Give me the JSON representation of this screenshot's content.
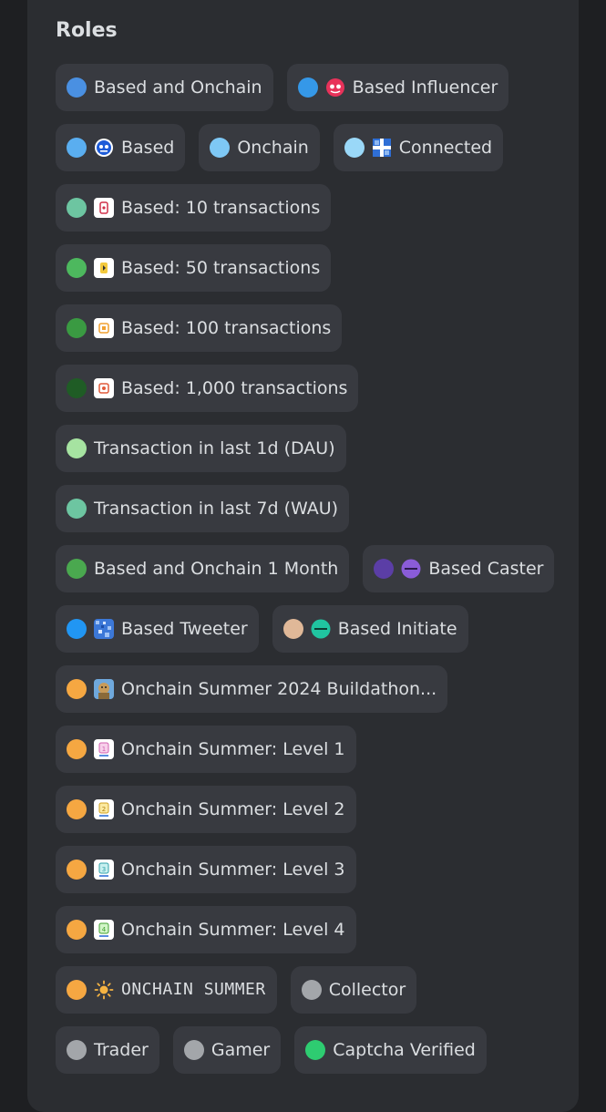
{
  "panel": {
    "title": "Roles"
  },
  "rows": [
    [
      {
        "label": "Based and Onchain",
        "dot": "#4a90e2",
        "icon": null
      },
      {
        "label": "Based Influencer",
        "dot": "#3598e8",
        "icon": "influencer-badge-icon"
      }
    ],
    [
      {
        "label": "Based",
        "dot": "#5aaef0",
        "icon": "based-badge-icon"
      },
      {
        "label": "Onchain",
        "dot": "#7ec8f5",
        "icon": null
      },
      {
        "label": "Connected",
        "dot": "#9ad8f8",
        "icon": "connected-badge-icon"
      }
    ],
    [
      {
        "label": "Based: 10 transactions",
        "dot": "#6dc5a1",
        "icon": "tx-10-badge-icon"
      }
    ],
    [
      {
        "label": "Based: 50 transactions",
        "dot": "#4db85e",
        "icon": "tx-50-badge-icon"
      }
    ],
    [
      {
        "label": "Based: 100 transactions",
        "dot": "#3a9a42",
        "icon": "tx-100-badge-icon"
      }
    ],
    [
      {
        "label": "Based: 1,000 transactions",
        "dot": "#1f5c25",
        "icon": "tx-1000-badge-icon"
      }
    ],
    [
      {
        "label": "Transaction in last 1d (DAU)",
        "dot": "#a6e3a1",
        "icon": null
      }
    ],
    [
      {
        "label": "Transaction in last 7d (WAU)",
        "dot": "#6dc5a1",
        "icon": null
      }
    ],
    [
      {
        "label": "Based and Onchain 1 Month",
        "dot": "#4aa84f",
        "icon": null
      },
      {
        "label": "Based Caster",
        "dot": "#5b3ea6",
        "icon": "caster-badge-icon"
      }
    ],
    [
      {
        "label": "Based Tweeter",
        "dot": "#2196f3",
        "icon": "tweeter-badge-icon"
      },
      {
        "label": "Based Initiate",
        "dot": "#e0b898",
        "icon": "initiate-badge-icon"
      }
    ],
    [
      {
        "label": "Onchain Summer 2024 Buildathon...",
        "dot": "#f5a742",
        "icon": "buildathon-badge-icon"
      }
    ],
    [
      {
        "label": "Onchain Summer: Level 1",
        "dot": "#f5a742",
        "icon": "summer-level-1-badge-icon"
      }
    ],
    [
      {
        "label": "Onchain Summer: Level 2",
        "dot": "#f5a742",
        "icon": "summer-level-2-badge-icon"
      }
    ],
    [
      {
        "label": "Onchain Summer: Level 3",
        "dot": "#f5a742",
        "icon": "summer-level-3-badge-icon"
      }
    ],
    [
      {
        "label": "Onchain Summer: Level 4",
        "dot": "#f5a742",
        "icon": "summer-level-4-badge-icon"
      }
    ],
    [
      {
        "label": "ONCHAIN SUMMER",
        "dot": "#f5a742",
        "icon": "sun-icon"
      },
      {
        "label": "Collector",
        "dot": "#a3a6aa",
        "icon": null
      }
    ],
    [
      {
        "label": "Trader",
        "dot": "#a3a6aa",
        "icon": null
      },
      {
        "label": "Gamer",
        "dot": "#a3a6aa",
        "icon": null
      },
      {
        "label": "Captcha Verified",
        "dot": "#2ecc71",
        "icon": null
      }
    ]
  ]
}
